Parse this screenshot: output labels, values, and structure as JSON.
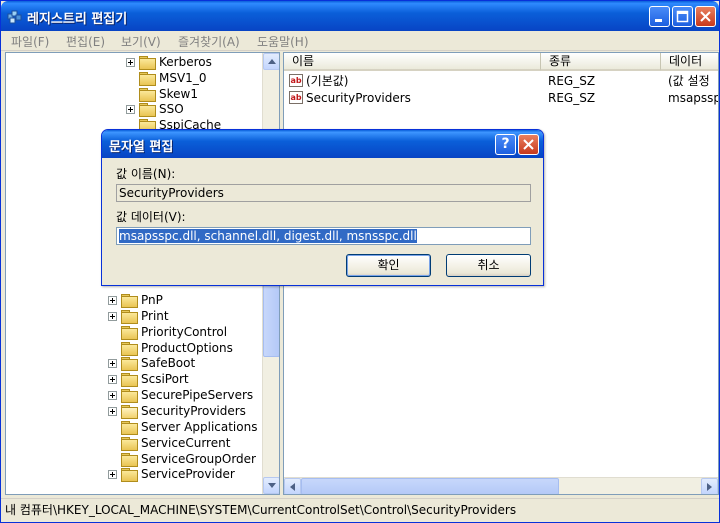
{
  "window": {
    "title": "레지스트리 편집기"
  },
  "menu": [
    "파일(F)",
    "편집(E)",
    "보기(V)",
    "즐겨찾기(A)",
    "도움말(H)"
  ],
  "tree": {
    "top_items": [
      {
        "label": "Kerberos",
        "expandable": true
      },
      {
        "label": "MSV1_0",
        "expandable": false
      },
      {
        "label": "Skew1",
        "expandable": false
      },
      {
        "label": "SSO",
        "expandable": true
      },
      {
        "label": "SspiCache",
        "expandable": false
      }
    ],
    "bottom_items": [
      {
        "label": "PnP",
        "expandable": true
      },
      {
        "label": "Print",
        "expandable": true
      },
      {
        "label": "PriorityControl",
        "expandable": false
      },
      {
        "label": "ProductOptions",
        "expandable": false
      },
      {
        "label": "SafeBoot",
        "expandable": true
      },
      {
        "label": "ScsiPort",
        "expandable": true
      },
      {
        "label": "SecurePipeServers",
        "expandable": true
      },
      {
        "label": "SecurityProviders",
        "expandable": true,
        "open": true
      },
      {
        "label": "Server Applications",
        "expandable": false
      },
      {
        "label": "ServiceCurrent",
        "expandable": false
      },
      {
        "label": "ServiceGroupOrder",
        "expandable": false
      },
      {
        "label": "ServiceProvider",
        "expandable": true
      }
    ]
  },
  "list": {
    "columns": [
      "이름",
      "종류",
      "데이터"
    ],
    "rows": [
      {
        "name": "(기본값)",
        "type": "REG_SZ",
        "data": "(값 설정"
      },
      {
        "name": "SecurityProviders",
        "type": "REG_SZ",
        "data": "msapssp"
      }
    ]
  },
  "status": "내 컴퓨터\\HKEY_LOCAL_MACHINE\\SYSTEM\\CurrentControlSet\\Control\\SecurityProviders",
  "dialog": {
    "title": "문자열 편집",
    "help_label": "?",
    "name_label": "값 이름(N):",
    "name_value": "SecurityProviders",
    "data_label": "값 데이터(V):",
    "data_value": "msapsspc.dll, schannel.dll, digest.dll, msnsspc.dll",
    "ok_label": "확인",
    "cancel_label": "취소"
  }
}
